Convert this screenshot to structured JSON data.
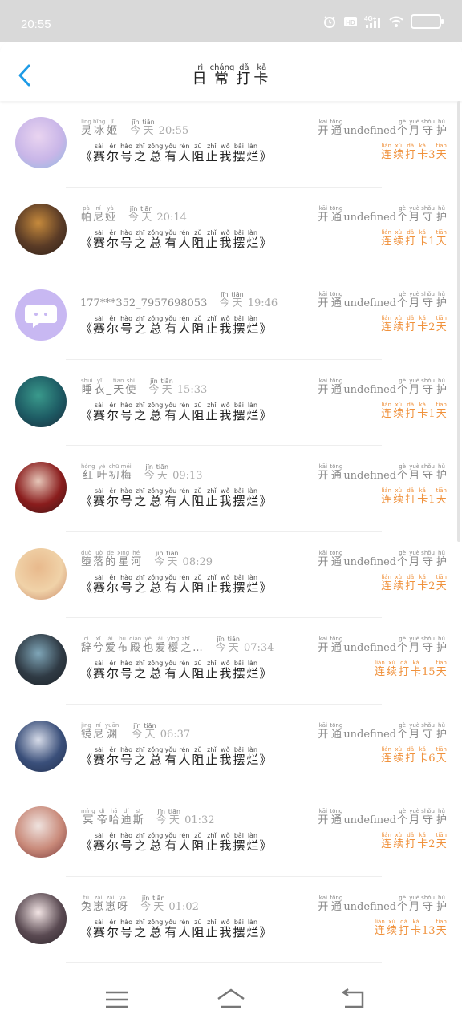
{
  "status_bar": {
    "time": "20:55",
    "icons": [
      "alarm-icon",
      "hd-icon",
      "4g-signal-icon",
      "wifi-icon",
      "battery-icon"
    ],
    "network": "4G+"
  },
  "header": {
    "back_icon": "chevron-left-icon",
    "title_chars": [
      {
        "ch": "日",
        "py": "rì"
      },
      {
        "ch": "常",
        "py": "cháng"
      },
      {
        "ch": "打",
        "py": "dǎ"
      },
      {
        "ch": "卡",
        "py": "kǎ"
      }
    ]
  },
  "colors": {
    "accent_blue": "#1e9be6",
    "streak_orange": "#f0913b",
    "status_bar_bg": "#d9d9d9"
  },
  "title_phrase": [
    {
      "ch": "赛",
      "py": "sài"
    },
    {
      "ch": "尔",
      "py": "ěr"
    },
    {
      "ch": "号",
      "py": "hào"
    },
    {
      "ch": "之",
      "py": "zhī"
    },
    {
      "ch": "总",
      "py": "zǒng"
    },
    {
      "ch": "有",
      "py": "yǒu"
    },
    {
      "ch": "人",
      "py": "rén"
    },
    {
      "ch": "阻",
      "py": "zǔ"
    },
    {
      "ch": "止",
      "py": "zhǐ"
    },
    {
      "ch": "我",
      "py": "wǒ"
    },
    {
      "ch": "摆",
      "py": "bǎi"
    },
    {
      "ch": "烂",
      "py": "làn"
    }
  ],
  "open_label": [
    {
      "ch": "开",
      "py": "kāi"
    },
    {
      "ch": "通",
      "py": "tōng"
    }
  ],
  "guard_label": [
    {
      "ch": "个",
      "py": "gè"
    },
    {
      "ch": "月",
      "py": "yuè"
    },
    {
      "ch": "守",
      "py": "shǒu"
    },
    {
      "ch": "护",
      "py": "hù"
    }
  ],
  "streak_label": [
    {
      "ch": "连",
      "py": "lián"
    },
    {
      "ch": "续",
      "py": "xù"
    },
    {
      "ch": "打",
      "py": "dǎ"
    },
    {
      "ch": "卡",
      "py": "kǎ"
    }
  ],
  "today": {
    "ch1": "今",
    "py1": "jīn",
    "ch2": "天",
    "py2": "tiān"
  },
  "bracket_open": "《",
  "bracket_close": "》",
  "undefined_text": "undefined",
  "day_unit": {
    "ch": "天",
    "py": "tiān"
  },
  "entries": [
    {
      "name_chars": [
        {
          "ch": "灵",
          "py": "líng"
        },
        {
          "ch": "冰",
          "py": "bīng"
        },
        {
          "ch": "姬",
          "py": "jī"
        }
      ],
      "time": "20:55",
      "streak": "3",
      "avatar_colors": [
        "#c9b6e8",
        "#e9d4f0",
        "#8fb9e0"
      ]
    },
    {
      "name_chars": [
        {
          "ch": "帕",
          "py": "pà"
        },
        {
          "ch": "尼",
          "py": "ní"
        },
        {
          "ch": "娅",
          "py": "yà"
        }
      ],
      "time": "20:14",
      "streak": "1",
      "avatar_colors": [
        "#5a3b26",
        "#c68a3c",
        "#2c1f18"
      ]
    },
    {
      "name_plain": "177***352_7957698053",
      "time": "19:46",
      "streak": "2",
      "avatar_colors": [
        "#c8b8f2",
        "#c8b8f2",
        "#ffffff"
      ]
    },
    {
      "name_chars": [
        {
          "ch": "睡",
          "py": "shuì"
        },
        {
          "ch": "衣",
          "py": "yī"
        },
        {
          "ch": "_",
          "py": ""
        },
        {
          "ch": "天",
          "py": "tiān"
        },
        {
          "ch": "使",
          "py": "shǐ"
        }
      ],
      "time": "15:33",
      "streak": "1",
      "avatar_colors": [
        "#1d5a63",
        "#3a9a8c",
        "#1a2a3a"
      ]
    },
    {
      "name_chars": [
        {
          "ch": "红",
          "py": "hóng"
        },
        {
          "ch": "叶",
          "py": "yè"
        },
        {
          "ch": "初",
          "py": "chū"
        },
        {
          "ch": "梅",
          "py": "méi"
        }
      ],
      "time": "09:13",
      "streak": "1",
      "avatar_colors": [
        "#8a1d1d",
        "#e6c6b8",
        "#3a1414"
      ]
    },
    {
      "name_chars": [
        {
          "ch": "堕",
          "py": "duò"
        },
        {
          "ch": "落",
          "py": "luò"
        },
        {
          "ch": "的",
          "py": "de"
        },
        {
          "ch": "星",
          "py": "xīng"
        },
        {
          "ch": "河",
          "py": "hé"
        }
      ],
      "time": "08:29",
      "streak": "2",
      "avatar_colors": [
        "#f0d2a8",
        "#e8b98c",
        "#c98a6a"
      ]
    },
    {
      "name_chars": [
        {
          "ch": "辞",
          "py": "cí"
        },
        {
          "ch": "兮",
          "py": "xī"
        },
        {
          "ch": "爱",
          "py": "ài"
        },
        {
          "ch": "布",
          "py": "bù"
        },
        {
          "ch": "殿",
          "py": "diàn"
        },
        {
          "ch": "也",
          "py": "yě"
        },
        {
          "ch": "爱",
          "py": "ài"
        },
        {
          "ch": "樱",
          "py": "yīng"
        },
        {
          "ch": "之",
          "py": "zhī"
        },
        {
          "ch": "...",
          "py": ""
        }
      ],
      "time": "07:34",
      "streak": "15",
      "avatar_colors": [
        "#2f3a44",
        "#7fa6b8",
        "#1c2228"
      ]
    },
    {
      "name_chars": [
        {
          "ch": "镜",
          "py": "jìng"
        },
        {
          "ch": "尼",
          "py": "ní"
        },
        {
          "ch": "渊",
          "py": "yuān"
        }
      ],
      "time": "06:37",
      "streak": "6",
      "avatar_colors": [
        "#3a4f7a",
        "#d6dbe8",
        "#22304e"
      ]
    },
    {
      "name_chars": [
        {
          "ch": "冥",
          "py": "míng"
        },
        {
          "ch": "帝",
          "py": "dì"
        },
        {
          "ch": "哈",
          "py": "hā"
        },
        {
          "ch": "迪",
          "py": "dí"
        },
        {
          "ch": "斯",
          "py": "sī"
        }
      ],
      "time": "01:32",
      "streak": "2",
      "avatar_colors": [
        "#c98a7a",
        "#efe3df",
        "#7a3a3a"
      ]
    },
    {
      "name_chars": [
        {
          "ch": "兔",
          "py": "tù"
        },
        {
          "ch": "崽",
          "py": "zǎi"
        },
        {
          "ch": "崽",
          "py": "zǎi"
        },
        {
          "ch": "呀",
          "py": "yā"
        }
      ],
      "time": "01:02",
      "streak": "13",
      "avatar_colors": [
        "#5a4a52",
        "#f2e4e4",
        "#2a2228"
      ]
    }
  ],
  "nav": {
    "menu_icon": "menu-icon",
    "home_icon": "home-icon",
    "back_icon": "return-icon"
  }
}
